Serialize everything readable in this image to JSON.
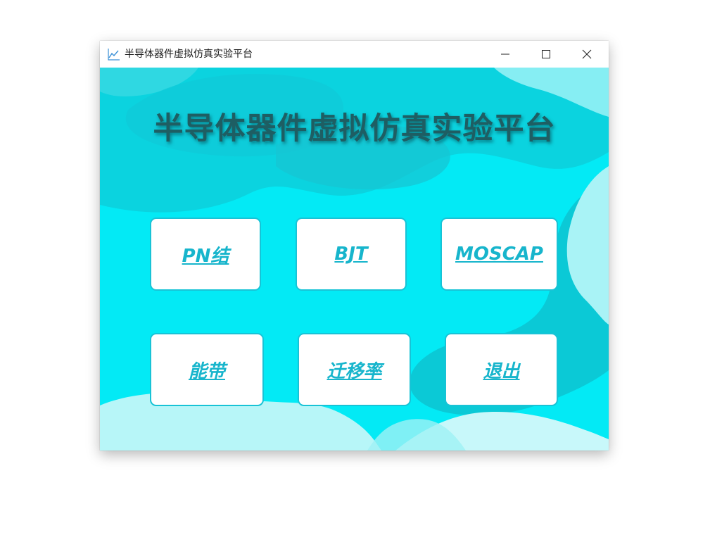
{
  "window": {
    "title": "半导体器件虚拟仿真实验平台",
    "app_icon": "line-chart-icon",
    "controls": {
      "minimize": "minimize-icon",
      "maximize": "maximize-icon",
      "close": "close-icon"
    }
  },
  "main": {
    "heading": "半导体器件虚拟仿真实验平台",
    "buttons": [
      {
        "label": "PN结"
      },
      {
        "label": "BJT"
      },
      {
        "label": "MOSCAP"
      },
      {
        "label": "能带"
      },
      {
        "label": "迁移率"
      },
      {
        "label": "退出"
      }
    ]
  },
  "colors": {
    "background_cyan": "#03eaf5",
    "dark_wave": "#0bcfdc",
    "light_wave": "#b7f6f8",
    "button_text": "#17b5cc",
    "button_border": "#18c3d6",
    "heading_text": "#1e5e63"
  }
}
